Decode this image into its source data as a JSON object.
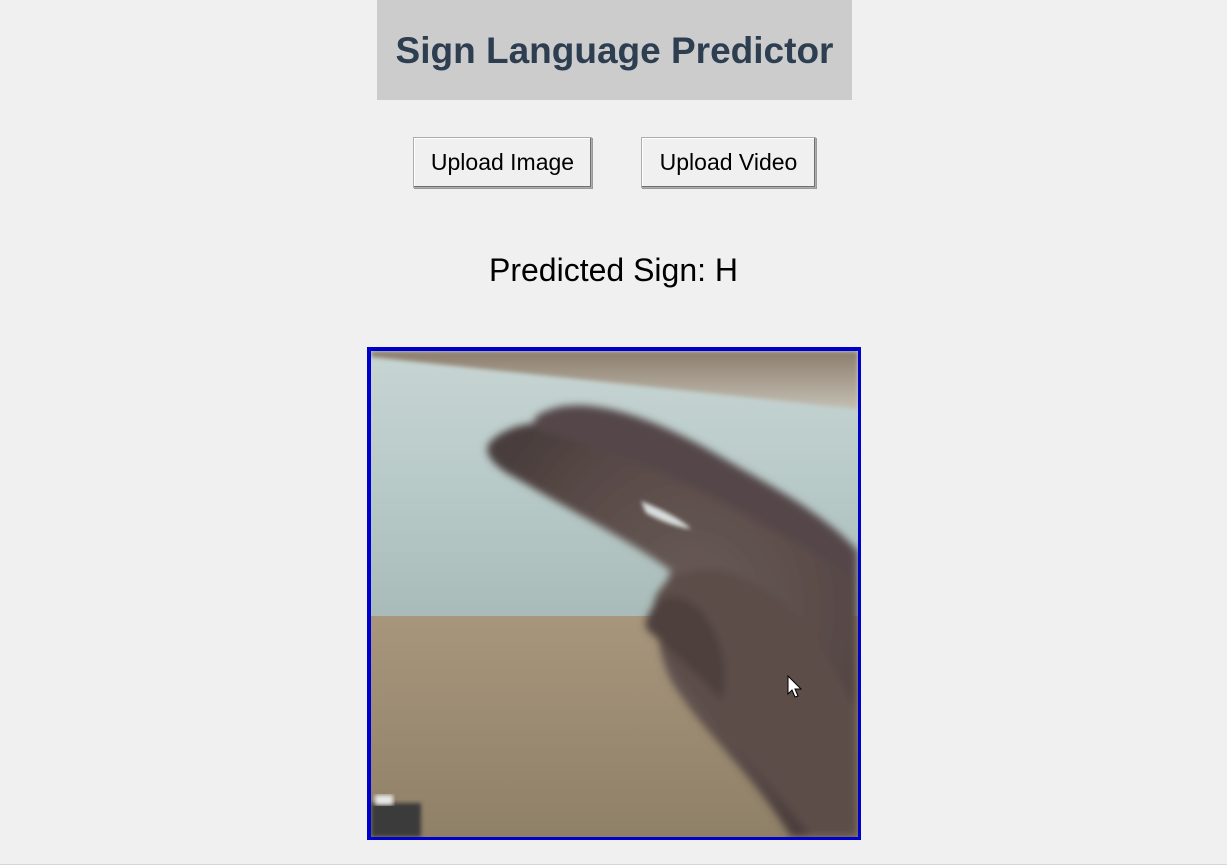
{
  "header": {
    "title": "Sign Language Predictor",
    "background": "#cccccc",
    "title_color": "#2c3e50"
  },
  "toolbar": {
    "upload_image_label": "Upload Image",
    "upload_video_label": "Upload Video"
  },
  "result": {
    "prediction_text": "Predicted Sign: H"
  },
  "preview": {
    "description_icon": "hand-sign-image",
    "border_color": "#0000cc"
  },
  "cursor": {
    "icon": "mouse-pointer-icon"
  }
}
